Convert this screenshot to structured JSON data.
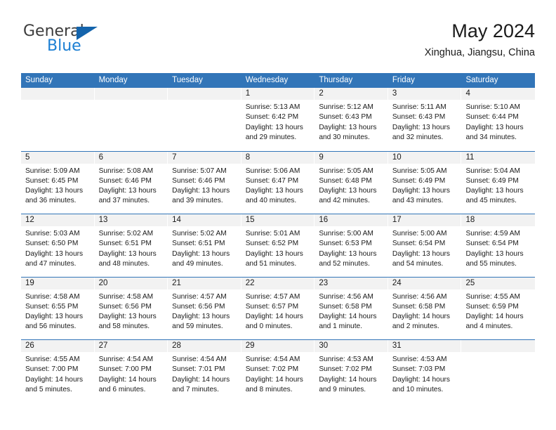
{
  "brand": {
    "name_top": "General",
    "name_bottom": "Blue",
    "triangle_color": "#1464ac",
    "blue_color": "#1c7fd3"
  },
  "header": {
    "title": "May 2024",
    "location": "Xinghua, Jiangsu, China"
  },
  "theme": {
    "header_blue": "#3275b8",
    "daynum_strip": "#f2f2f2",
    "text": "#1a1a1a"
  },
  "weekdays": [
    "Sunday",
    "Monday",
    "Tuesday",
    "Wednesday",
    "Thursday",
    "Friday",
    "Saturday"
  ],
  "weeks": [
    [
      {
        "day": "",
        "lines": []
      },
      {
        "day": "",
        "lines": []
      },
      {
        "day": "",
        "lines": []
      },
      {
        "day": "1",
        "lines": [
          "Sunrise: 5:13 AM",
          "Sunset: 6:42 PM",
          "Daylight: 13 hours",
          "and 29 minutes."
        ]
      },
      {
        "day": "2",
        "lines": [
          "Sunrise: 5:12 AM",
          "Sunset: 6:43 PM",
          "Daylight: 13 hours",
          "and 30 minutes."
        ]
      },
      {
        "day": "3",
        "lines": [
          "Sunrise: 5:11 AM",
          "Sunset: 6:43 PM",
          "Daylight: 13 hours",
          "and 32 minutes."
        ]
      },
      {
        "day": "4",
        "lines": [
          "Sunrise: 5:10 AM",
          "Sunset: 6:44 PM",
          "Daylight: 13 hours",
          "and 34 minutes."
        ]
      }
    ],
    [
      {
        "day": "5",
        "lines": [
          "Sunrise: 5:09 AM",
          "Sunset: 6:45 PM",
          "Daylight: 13 hours",
          "and 36 minutes."
        ]
      },
      {
        "day": "6",
        "lines": [
          "Sunrise: 5:08 AM",
          "Sunset: 6:46 PM",
          "Daylight: 13 hours",
          "and 37 minutes."
        ]
      },
      {
        "day": "7",
        "lines": [
          "Sunrise: 5:07 AM",
          "Sunset: 6:46 PM",
          "Daylight: 13 hours",
          "and 39 minutes."
        ]
      },
      {
        "day": "8",
        "lines": [
          "Sunrise: 5:06 AM",
          "Sunset: 6:47 PM",
          "Daylight: 13 hours",
          "and 40 minutes."
        ]
      },
      {
        "day": "9",
        "lines": [
          "Sunrise: 5:05 AM",
          "Sunset: 6:48 PM",
          "Daylight: 13 hours",
          "and 42 minutes."
        ]
      },
      {
        "day": "10",
        "lines": [
          "Sunrise: 5:05 AM",
          "Sunset: 6:49 PM",
          "Daylight: 13 hours",
          "and 43 minutes."
        ]
      },
      {
        "day": "11",
        "lines": [
          "Sunrise: 5:04 AM",
          "Sunset: 6:49 PM",
          "Daylight: 13 hours",
          "and 45 minutes."
        ]
      }
    ],
    [
      {
        "day": "12",
        "lines": [
          "Sunrise: 5:03 AM",
          "Sunset: 6:50 PM",
          "Daylight: 13 hours",
          "and 47 minutes."
        ]
      },
      {
        "day": "13",
        "lines": [
          "Sunrise: 5:02 AM",
          "Sunset: 6:51 PM",
          "Daylight: 13 hours",
          "and 48 minutes."
        ]
      },
      {
        "day": "14",
        "lines": [
          "Sunrise: 5:02 AM",
          "Sunset: 6:51 PM",
          "Daylight: 13 hours",
          "and 49 minutes."
        ]
      },
      {
        "day": "15",
        "lines": [
          "Sunrise: 5:01 AM",
          "Sunset: 6:52 PM",
          "Daylight: 13 hours",
          "and 51 minutes."
        ]
      },
      {
        "day": "16",
        "lines": [
          "Sunrise: 5:00 AM",
          "Sunset: 6:53 PM",
          "Daylight: 13 hours",
          "and 52 minutes."
        ]
      },
      {
        "day": "17",
        "lines": [
          "Sunrise: 5:00 AM",
          "Sunset: 6:54 PM",
          "Daylight: 13 hours",
          "and 54 minutes."
        ]
      },
      {
        "day": "18",
        "lines": [
          "Sunrise: 4:59 AM",
          "Sunset: 6:54 PM",
          "Daylight: 13 hours",
          "and 55 minutes."
        ]
      }
    ],
    [
      {
        "day": "19",
        "lines": [
          "Sunrise: 4:58 AM",
          "Sunset: 6:55 PM",
          "Daylight: 13 hours",
          "and 56 minutes."
        ]
      },
      {
        "day": "20",
        "lines": [
          "Sunrise: 4:58 AM",
          "Sunset: 6:56 PM",
          "Daylight: 13 hours",
          "and 58 minutes."
        ]
      },
      {
        "day": "21",
        "lines": [
          "Sunrise: 4:57 AM",
          "Sunset: 6:56 PM",
          "Daylight: 13 hours",
          "and 59 minutes."
        ]
      },
      {
        "day": "22",
        "lines": [
          "Sunrise: 4:57 AM",
          "Sunset: 6:57 PM",
          "Daylight: 14 hours",
          "and 0 minutes."
        ]
      },
      {
        "day": "23",
        "lines": [
          "Sunrise: 4:56 AM",
          "Sunset: 6:58 PM",
          "Daylight: 14 hours",
          "and 1 minute."
        ]
      },
      {
        "day": "24",
        "lines": [
          "Sunrise: 4:56 AM",
          "Sunset: 6:58 PM",
          "Daylight: 14 hours",
          "and 2 minutes."
        ]
      },
      {
        "day": "25",
        "lines": [
          "Sunrise: 4:55 AM",
          "Sunset: 6:59 PM",
          "Daylight: 14 hours",
          "and 4 minutes."
        ]
      }
    ],
    [
      {
        "day": "26",
        "lines": [
          "Sunrise: 4:55 AM",
          "Sunset: 7:00 PM",
          "Daylight: 14 hours",
          "and 5 minutes."
        ]
      },
      {
        "day": "27",
        "lines": [
          "Sunrise: 4:54 AM",
          "Sunset: 7:00 PM",
          "Daylight: 14 hours",
          "and 6 minutes."
        ]
      },
      {
        "day": "28",
        "lines": [
          "Sunrise: 4:54 AM",
          "Sunset: 7:01 PM",
          "Daylight: 14 hours",
          "and 7 minutes."
        ]
      },
      {
        "day": "29",
        "lines": [
          "Sunrise: 4:54 AM",
          "Sunset: 7:02 PM",
          "Daylight: 14 hours",
          "and 8 minutes."
        ]
      },
      {
        "day": "30",
        "lines": [
          "Sunrise: 4:53 AM",
          "Sunset: 7:02 PM",
          "Daylight: 14 hours",
          "and 9 minutes."
        ]
      },
      {
        "day": "31",
        "lines": [
          "Sunrise: 4:53 AM",
          "Sunset: 7:03 PM",
          "Daylight: 14 hours",
          "and 10 minutes."
        ]
      },
      {
        "day": "",
        "lines": []
      }
    ]
  ]
}
